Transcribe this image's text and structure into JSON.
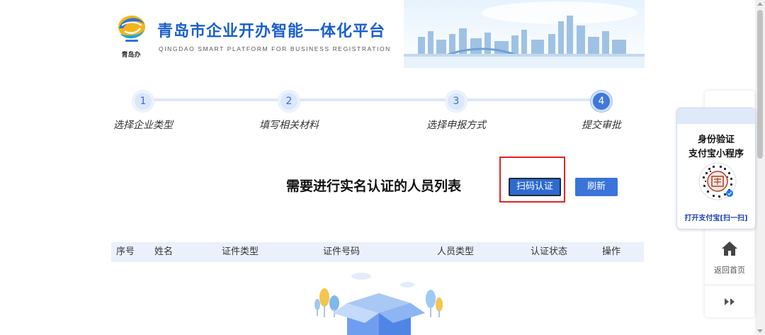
{
  "header": {
    "logo_caption": "青岛办",
    "title": "青岛市企业开办智能一体化平台",
    "subtitle": "QINGDAO SMART PLATFORM FOR BUSINESS REGISTRATION"
  },
  "steps": [
    {
      "number": "1",
      "label": "选择企业类型",
      "active": false
    },
    {
      "number": "2",
      "label": "填写相关材料",
      "active": false
    },
    {
      "number": "3",
      "label": "选择申报方式",
      "active": false
    },
    {
      "number": "4",
      "label": "提交审批",
      "active": true
    }
  ],
  "main": {
    "list_title": "需要进行实名认证的人员列表",
    "scan_button": "扫码认证",
    "refresh_button": "刷新"
  },
  "table": {
    "columns": [
      "序号",
      "姓名",
      "证件类型",
      "证件号码",
      "人员类型",
      "认证状态",
      "操作"
    ],
    "rows": []
  },
  "side_panel": {
    "qr_line1": "身份验证",
    "qr_line2": "支付宝小程序",
    "qr_caption": "打开支付宝[扫一扫]",
    "home_label": "返回首页"
  },
  "colors": {
    "brand_blue": "#1a5fd0",
    "button_blue": "#2f6ad0",
    "highlight_red": "#e52222",
    "table_header_bg": "#eaf1fb"
  }
}
